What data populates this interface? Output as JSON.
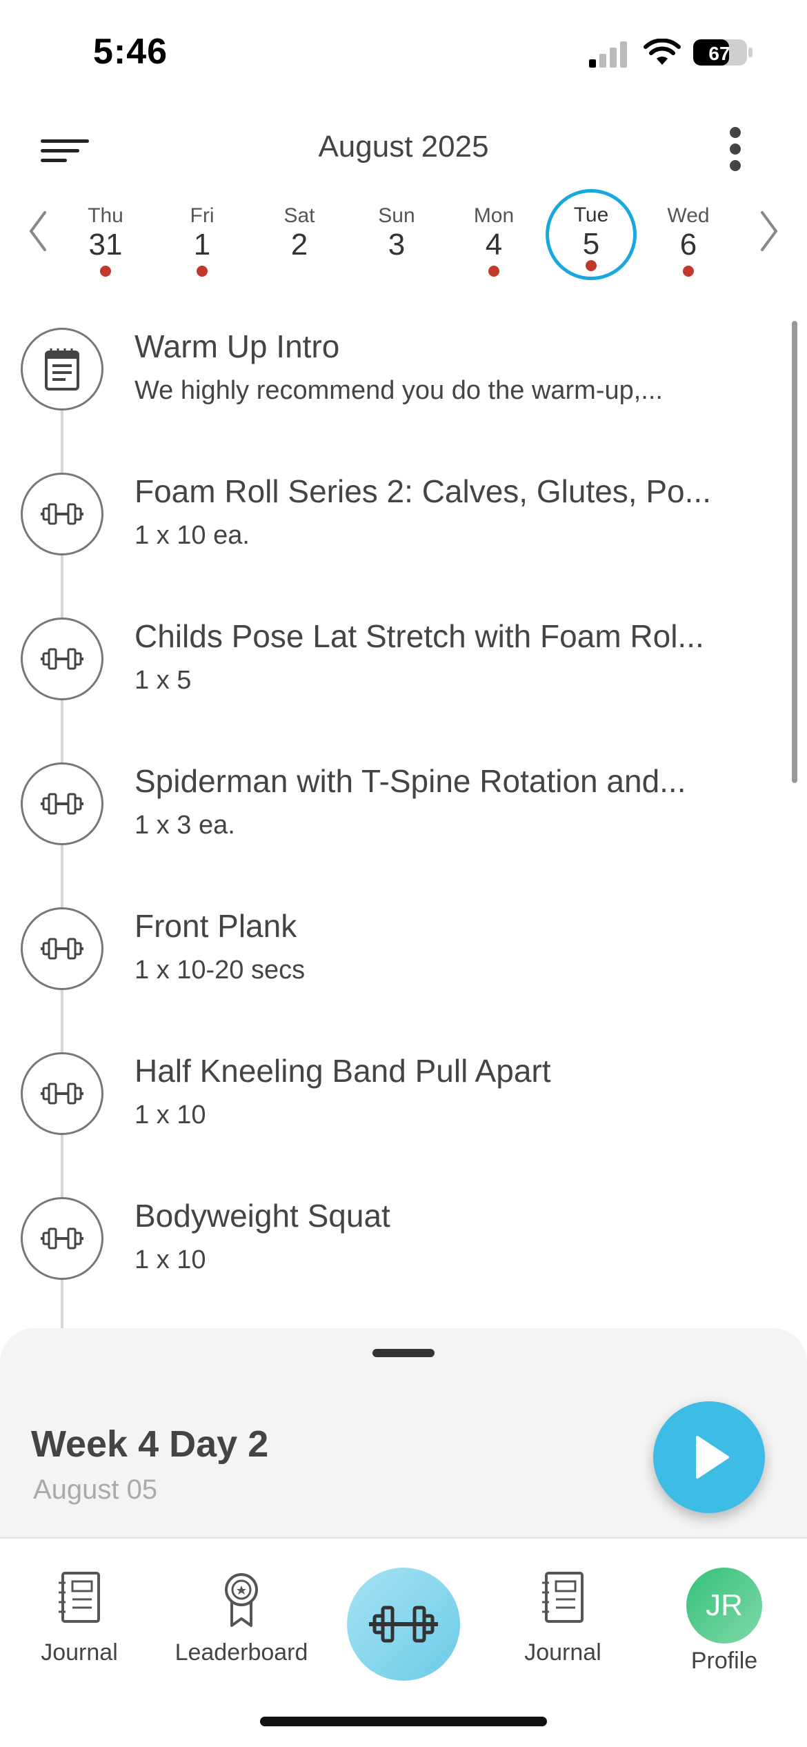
{
  "status_bar": {
    "time": "5:46",
    "battery": "67"
  },
  "header": {
    "month_title": "August 2025"
  },
  "week": [
    {
      "name": "Thu",
      "num": "31",
      "dot": true,
      "selected": false
    },
    {
      "name": "Fri",
      "num": "1",
      "dot": true,
      "selected": false
    },
    {
      "name": "Sat",
      "num": "2",
      "dot": false,
      "selected": false
    },
    {
      "name": "Sun",
      "num": "3",
      "dot": false,
      "selected": false
    },
    {
      "name": "Mon",
      "num": "4",
      "dot": true,
      "selected": false
    },
    {
      "name": "Tue",
      "num": "5",
      "dot": true,
      "selected": true
    },
    {
      "name": "Wed",
      "num": "6",
      "dot": true,
      "selected": false
    }
  ],
  "exercises": [
    {
      "icon": "notepad-icon",
      "title": "Warm Up Intro",
      "sub": "We highly recommend you do the warm-up,..."
    },
    {
      "icon": "dumbbell-icon",
      "title": "Foam Roll Series 2: Calves, Glutes, Po...",
      "sub": "1 x 10 ea."
    },
    {
      "icon": "dumbbell-icon",
      "title": "Childs Pose Lat Stretch with Foam Rol...",
      "sub": "1 x 5"
    },
    {
      "icon": "dumbbell-icon",
      "title": "Spiderman with T-Spine Rotation and...",
      "sub": "1 x 3 ea."
    },
    {
      "icon": "dumbbell-icon",
      "title": "Front Plank",
      "sub": "1 x 10-20 secs"
    },
    {
      "icon": "dumbbell-icon",
      "title": "Half Kneeling Band Pull Apart",
      "sub": "1 x 10"
    },
    {
      "icon": "dumbbell-icon",
      "title": "Bodyweight Squat",
      "sub": "1 x 10"
    }
  ],
  "sheet": {
    "title": "Week 4 Day 2",
    "subtitle": "August 05"
  },
  "tabs": {
    "journal_1": "Journal",
    "leaderboard": "Leaderboard",
    "journal_2": "Journal",
    "profile": "Profile",
    "avatar_initials": "JR"
  },
  "colors": {
    "accent": "#1aa7e0",
    "play": "#3dbde5",
    "dot": "#c0392b",
    "avatar": "#34c17a"
  }
}
